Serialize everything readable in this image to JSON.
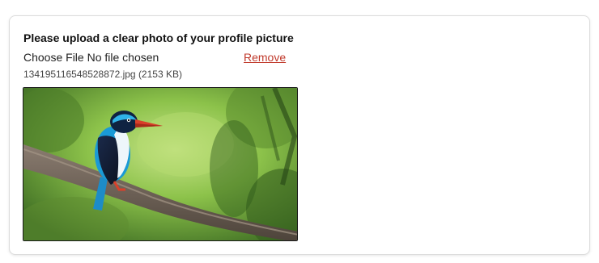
{
  "form": {
    "title": "Please upload a clear photo of your profile picture",
    "choose_file_label": "Choose File",
    "no_file_text": "No file chosen",
    "remove_label": "Remove",
    "file_name": "134195116548528872.jpg",
    "file_size": "(2153 KB)"
  },
  "colors": {
    "remove_link": "#c0392b",
    "card_border": "#dcdcdc"
  }
}
